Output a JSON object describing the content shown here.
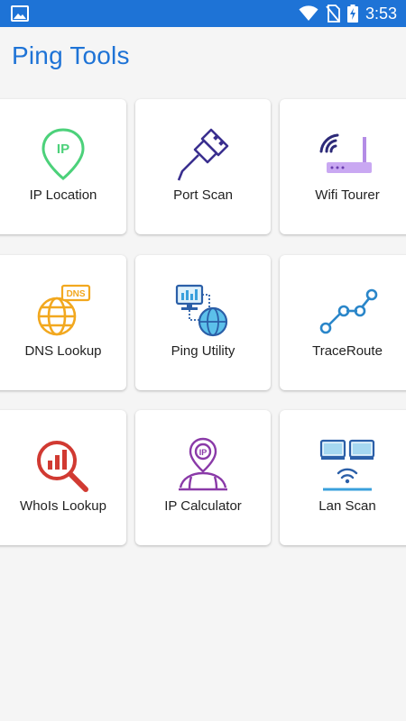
{
  "status_bar": {
    "time": "3:53",
    "color": "#1e73d6"
  },
  "app": {
    "title": "Ping Tools",
    "accent": "#1e73d6"
  },
  "tools": [
    {
      "label": "IP Location",
      "icon": "ip-location-pin-icon"
    },
    {
      "label": "Port Scan",
      "icon": "usb-plug-icon"
    },
    {
      "label": "Wifi Tourer",
      "icon": "wifi-router-icon"
    },
    {
      "label": "DNS Lookup",
      "icon": "dns-globe-icon"
    },
    {
      "label": "Ping Utility",
      "icon": "computer-globe-icon"
    },
    {
      "label": "TraceRoute",
      "icon": "route-nodes-icon"
    },
    {
      "label": "WhoIs Lookup",
      "icon": "magnifier-chart-icon"
    },
    {
      "label": "IP Calculator",
      "icon": "ip-pin-map-icon"
    },
    {
      "label": "Lan Scan",
      "icon": "lan-computers-wifi-icon"
    }
  ]
}
